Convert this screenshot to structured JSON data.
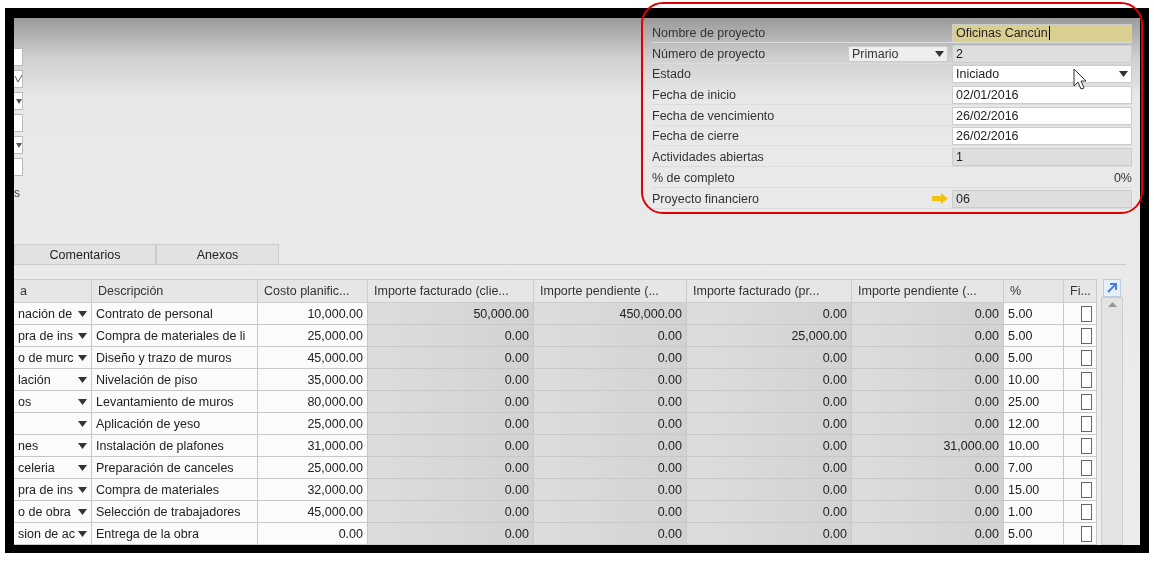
{
  "left_fields": [
    {
      "kind": "plain"
    },
    {
      "kind": "check"
    },
    {
      "kind": "dropdown"
    },
    {
      "kind": "plain"
    },
    {
      "kind": "dropdown"
    },
    {
      "kind": "plain"
    }
  ],
  "left_label": "s",
  "form": [
    {
      "label": "Nombre de proyecto",
      "value": "Oficinas Cancún",
      "kind": "text",
      "focused": true
    },
    {
      "label": "Número de proyecto",
      "value": "2",
      "kind": "readonly",
      "selector": "Primario"
    },
    {
      "label": "Estado",
      "value": "Iniciado",
      "kind": "dropdown"
    },
    {
      "label": "Fecha de inicio",
      "value": "02/01/2016",
      "kind": "text",
      "focused": false
    },
    {
      "label": "Fecha de vencimiento",
      "value": "26/02/2016",
      "kind": "text",
      "focused": false
    },
    {
      "label": "Fecha de cierre",
      "value": "26/02/2016",
      "kind": "text",
      "focused": false
    },
    {
      "label": "Actividades abiertas",
      "value": "1",
      "kind": "readonly"
    },
    {
      "label": "% de completo",
      "value": "0%",
      "kind": "plain"
    },
    {
      "label": "Proyecto financiero",
      "value": "06",
      "kind": "link"
    }
  ],
  "tabs": [
    {
      "label": "Comentarios",
      "selected": false
    },
    {
      "label": "Anexos",
      "selected": false
    }
  ],
  "table": {
    "columns": [
      {
        "label": "a",
        "kind": "dropdown",
        "editable": true
      },
      {
        "label": "Descripción",
        "kind": "text",
        "editable": true
      },
      {
        "label": "Costo planific...",
        "kind": "number",
        "editable": true
      },
      {
        "label": "Importe facturado (clie...",
        "kind": "number",
        "editable": false
      },
      {
        "label": "Importe pendiente (...",
        "kind": "number",
        "editable": false
      },
      {
        "label": "Importe facturado (pr...",
        "kind": "number",
        "editable": false
      },
      {
        "label": "Importe pendiente (...",
        "kind": "number",
        "editable": false
      },
      {
        "label": "%",
        "kind": "text",
        "editable": true
      },
      {
        "label": "Fi...",
        "kind": "check",
        "editable": true
      }
    ],
    "rows": [
      {
        "cells": [
          "nación de",
          "Contrato de personal",
          "10,000.00",
          "50,000.00",
          "450,000.00",
          "0.00",
          "0.00",
          "5.00"
        ],
        "checked": false
      },
      {
        "cells": [
          "pra de ins",
          "Compra de materiales de li",
          "25,000.00",
          "0.00",
          "0.00",
          "25,000.00",
          "0.00",
          "5.00"
        ],
        "checked": false
      },
      {
        "cells": [
          "o de murc",
          "Diseño y trazo de muros",
          "45,000.00",
          "0.00",
          "0.00",
          "0.00",
          "0.00",
          "5.00"
        ],
        "checked": false
      },
      {
        "cells": [
          "lación",
          "Nivelación de piso",
          "35,000.00",
          "0.00",
          "0.00",
          "0.00",
          "0.00",
          "10.00"
        ],
        "checked": false
      },
      {
        "cells": [
          "os",
          "Levantamiento de muros",
          "80,000.00",
          "0.00",
          "0.00",
          "0.00",
          "0.00",
          "25.00"
        ],
        "checked": false
      },
      {
        "cells": [
          "",
          "Aplicación de yeso",
          "25,000.00",
          "0.00",
          "0.00",
          "0.00",
          "0.00",
          "12.00"
        ],
        "checked": false
      },
      {
        "cells": [
          "nes",
          "Instalación de plafones",
          "31,000.00",
          "0.00",
          "0.00",
          "0.00",
          "31,000.00",
          "10.00"
        ],
        "checked": false
      },
      {
        "cells": [
          "celeria",
          "Preparación de canceles",
          "25,000.00",
          "0.00",
          "0.00",
          "0.00",
          "0.00",
          "7.00"
        ],
        "checked": false
      },
      {
        "cells": [
          "pra de ins",
          "Compra de materiales",
          "32,000.00",
          "0.00",
          "0.00",
          "0.00",
          "0.00",
          "15.00"
        ],
        "checked": false
      },
      {
        "cells": [
          "o de obra",
          "Selección de trabajadores",
          "45,000.00",
          "0.00",
          "0.00",
          "0.00",
          "0.00",
          "1.00"
        ],
        "checked": false
      },
      {
        "cells": [
          "sion de ac",
          "Entrega de la obra",
          "0.00",
          "0.00",
          "0.00",
          "0.00",
          "0.00",
          "5.00"
        ],
        "checked": false
      }
    ]
  }
}
